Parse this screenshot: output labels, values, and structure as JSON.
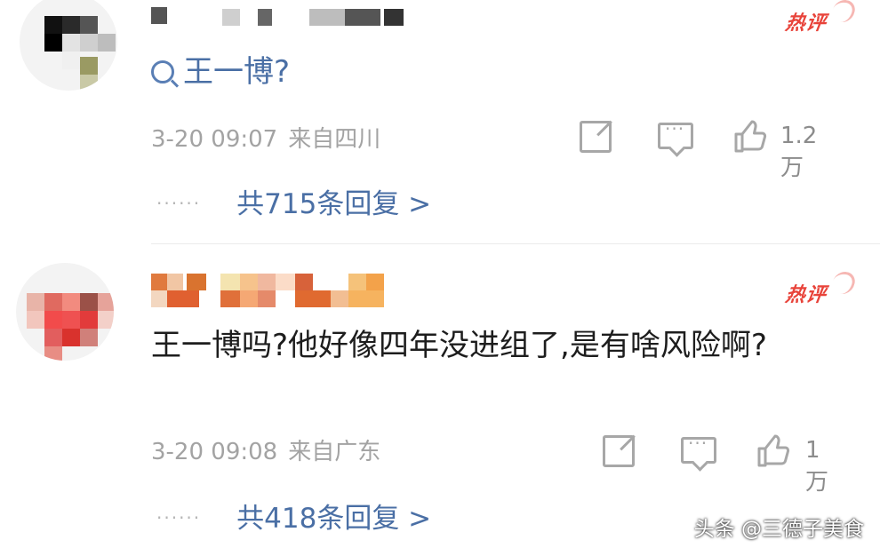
{
  "comments": [
    {
      "badge": "热评",
      "content_prefix": "",
      "content_link": "王一博?",
      "time": "3-20 09:07",
      "location": "来自四川",
      "like_count": "1.2万",
      "replies": "共715条回复 >"
    },
    {
      "badge": "热评",
      "content": "王一博吗?他好像四年没进组了,是有啥风险啊?",
      "time": "3-20 09:08",
      "location": "来自广东",
      "like_count": "1万",
      "replies": "共418条回复 >"
    }
  ],
  "watermark": "头条 @三德子美食",
  "colors": {
    "link": "#4a6fa5",
    "badge": "#e8433a",
    "meta": "#a3a3a3"
  }
}
